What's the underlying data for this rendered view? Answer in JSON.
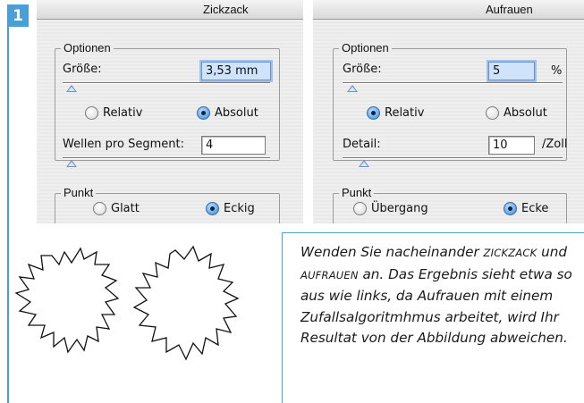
{
  "step_number": "1",
  "panel_zickzack": {
    "title": "Zickzack",
    "options_label": "Optionen",
    "size_label": "Größe:",
    "size_value": "3,53 mm",
    "mode_relative": "Relativ",
    "mode_absolute": "Absolut",
    "mode_selected": "absolute",
    "waves_label": "Wellen pro Segment:",
    "waves_value": "4",
    "point_label": "Punkt",
    "point_smooth": "Glatt",
    "point_corner": "Eckig",
    "point_selected": "corner"
  },
  "panel_aufrauen": {
    "title": "Aufrauen",
    "options_label": "Optionen",
    "size_label": "Größe:",
    "size_value": "5",
    "size_unit": "%",
    "mode_relative": "Relativ",
    "mode_absolute": "Absolut",
    "mode_selected": "relative",
    "detail_label": "Detail:",
    "detail_value": "10",
    "detail_unit": "/Zoll",
    "point_label": "Punkt",
    "point_smooth": "Übergang",
    "point_corner": "Ecke",
    "point_selected": "corner"
  },
  "note": {
    "part1": "Wenden Sie nacheinander ",
    "zickzack": "Zickzack",
    "part2": " und ",
    "aufrauen": "Aufrauen",
    "part3": " an. Das Ergebnis sieht etwa so aus wie links, da Aufrauen mit einem Zufallsalgoritmhmus arbeitet, wird Ihr Resultat von der Abbildung abweichen."
  },
  "colors": {
    "accent": "#4a9fd6",
    "radio_selected": "#3a86d6",
    "field_focus": "#cfe3fb"
  }
}
